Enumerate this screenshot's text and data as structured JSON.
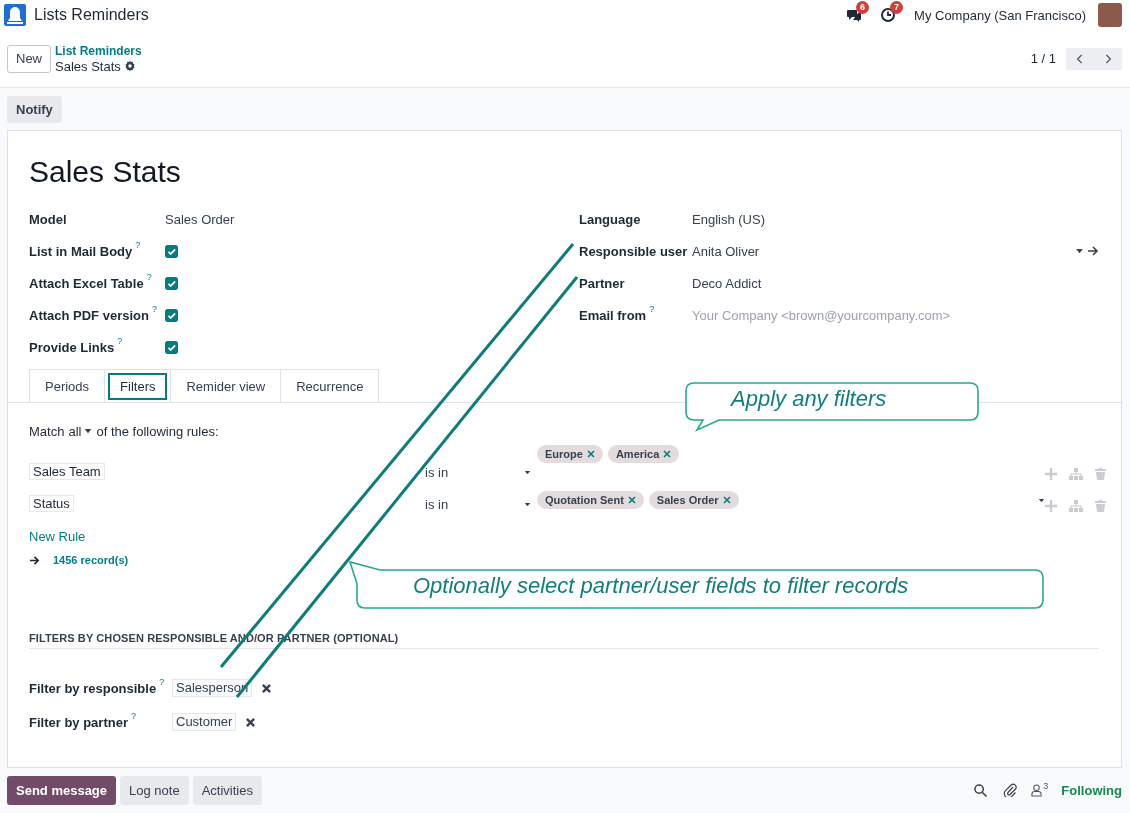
{
  "app": {
    "title": "Lists Reminders"
  },
  "systray": {
    "messages_count": "6",
    "activities_count": "7",
    "company": "My Company (San Francisco)"
  },
  "control_panel": {
    "new_button": "New",
    "breadcrumb_parent": "List Reminders",
    "breadcrumb_current": "Sales Stats",
    "pager": "1 / 1"
  },
  "action_buttons": [
    "Notify"
  ],
  "record": {
    "title": "Sales Stats",
    "left_fields": [
      {
        "kind": "text",
        "label": "Model",
        "value": "Sales Order"
      },
      {
        "kind": "checkbox",
        "label": "List in Mail Body",
        "help_mark": "?",
        "checked": true
      },
      {
        "kind": "checkbox",
        "label": "Attach Excel Table",
        "help_mark": "?",
        "checked": true
      },
      {
        "kind": "checkbox",
        "label": "Attach PDF version",
        "help_mark": "?",
        "checked": true
      },
      {
        "kind": "checkbox",
        "label": "Provide Links",
        "help_mark": "?",
        "checked": true
      }
    ],
    "right_fields": [
      {
        "kind": "text",
        "label": "Language",
        "value": "English (US)"
      },
      {
        "kind": "many2one",
        "label": "Responsible user",
        "value": "Anita Oliver"
      },
      {
        "kind": "text",
        "label": "Partner",
        "value": "Deco Addict"
      },
      {
        "kind": "input",
        "label": "Email from",
        "help_mark": "?",
        "placeholder": "Your Company <brown@yourcompany.com>"
      }
    ]
  },
  "tabs": [
    {
      "label": "Periods",
      "selected": false
    },
    {
      "label": "Filters",
      "selected": true
    },
    {
      "label": "Remider view",
      "selected": false
    },
    {
      "label": "Recurrence",
      "selected": false
    }
  ],
  "domain": {
    "match_prefix": "Match",
    "match_mode": "all",
    "match_suffix": "of the following rules:",
    "rules": [
      {
        "field": "Sales Team",
        "operator": "is in",
        "values": [
          "Europe",
          "America"
        ],
        "values_caret": false
      },
      {
        "field": "Status",
        "operator": "is in",
        "values": [
          "Quotation Sent",
          "Sales Order"
        ],
        "values_caret": true
      }
    ],
    "new_rule": "New Rule",
    "records": "1456 record(s)"
  },
  "responsible_section": {
    "heading": "FILTERS BY CHOSEN RESPONSIBLE AND/OR PARTNER (OPTIONAL)",
    "fields": [
      {
        "label": "Filter by responsible",
        "help_mark": "?",
        "value": "Salesperson"
      },
      {
        "label": "Filter by partner",
        "help_mark": "?",
        "value": "Customer"
      }
    ]
  },
  "chatter": {
    "buttons": [
      {
        "label": "Send message",
        "primary": true
      },
      {
        "label": "Log note",
        "primary": false
      },
      {
        "label": "Activities",
        "primary": false
      }
    ],
    "followers_count": "3",
    "follow_status": "Following"
  },
  "annotations": [
    {
      "text": "Apply any filters"
    },
    {
      "text": "Optionally select partner/user fields to filter records"
    }
  ]
}
